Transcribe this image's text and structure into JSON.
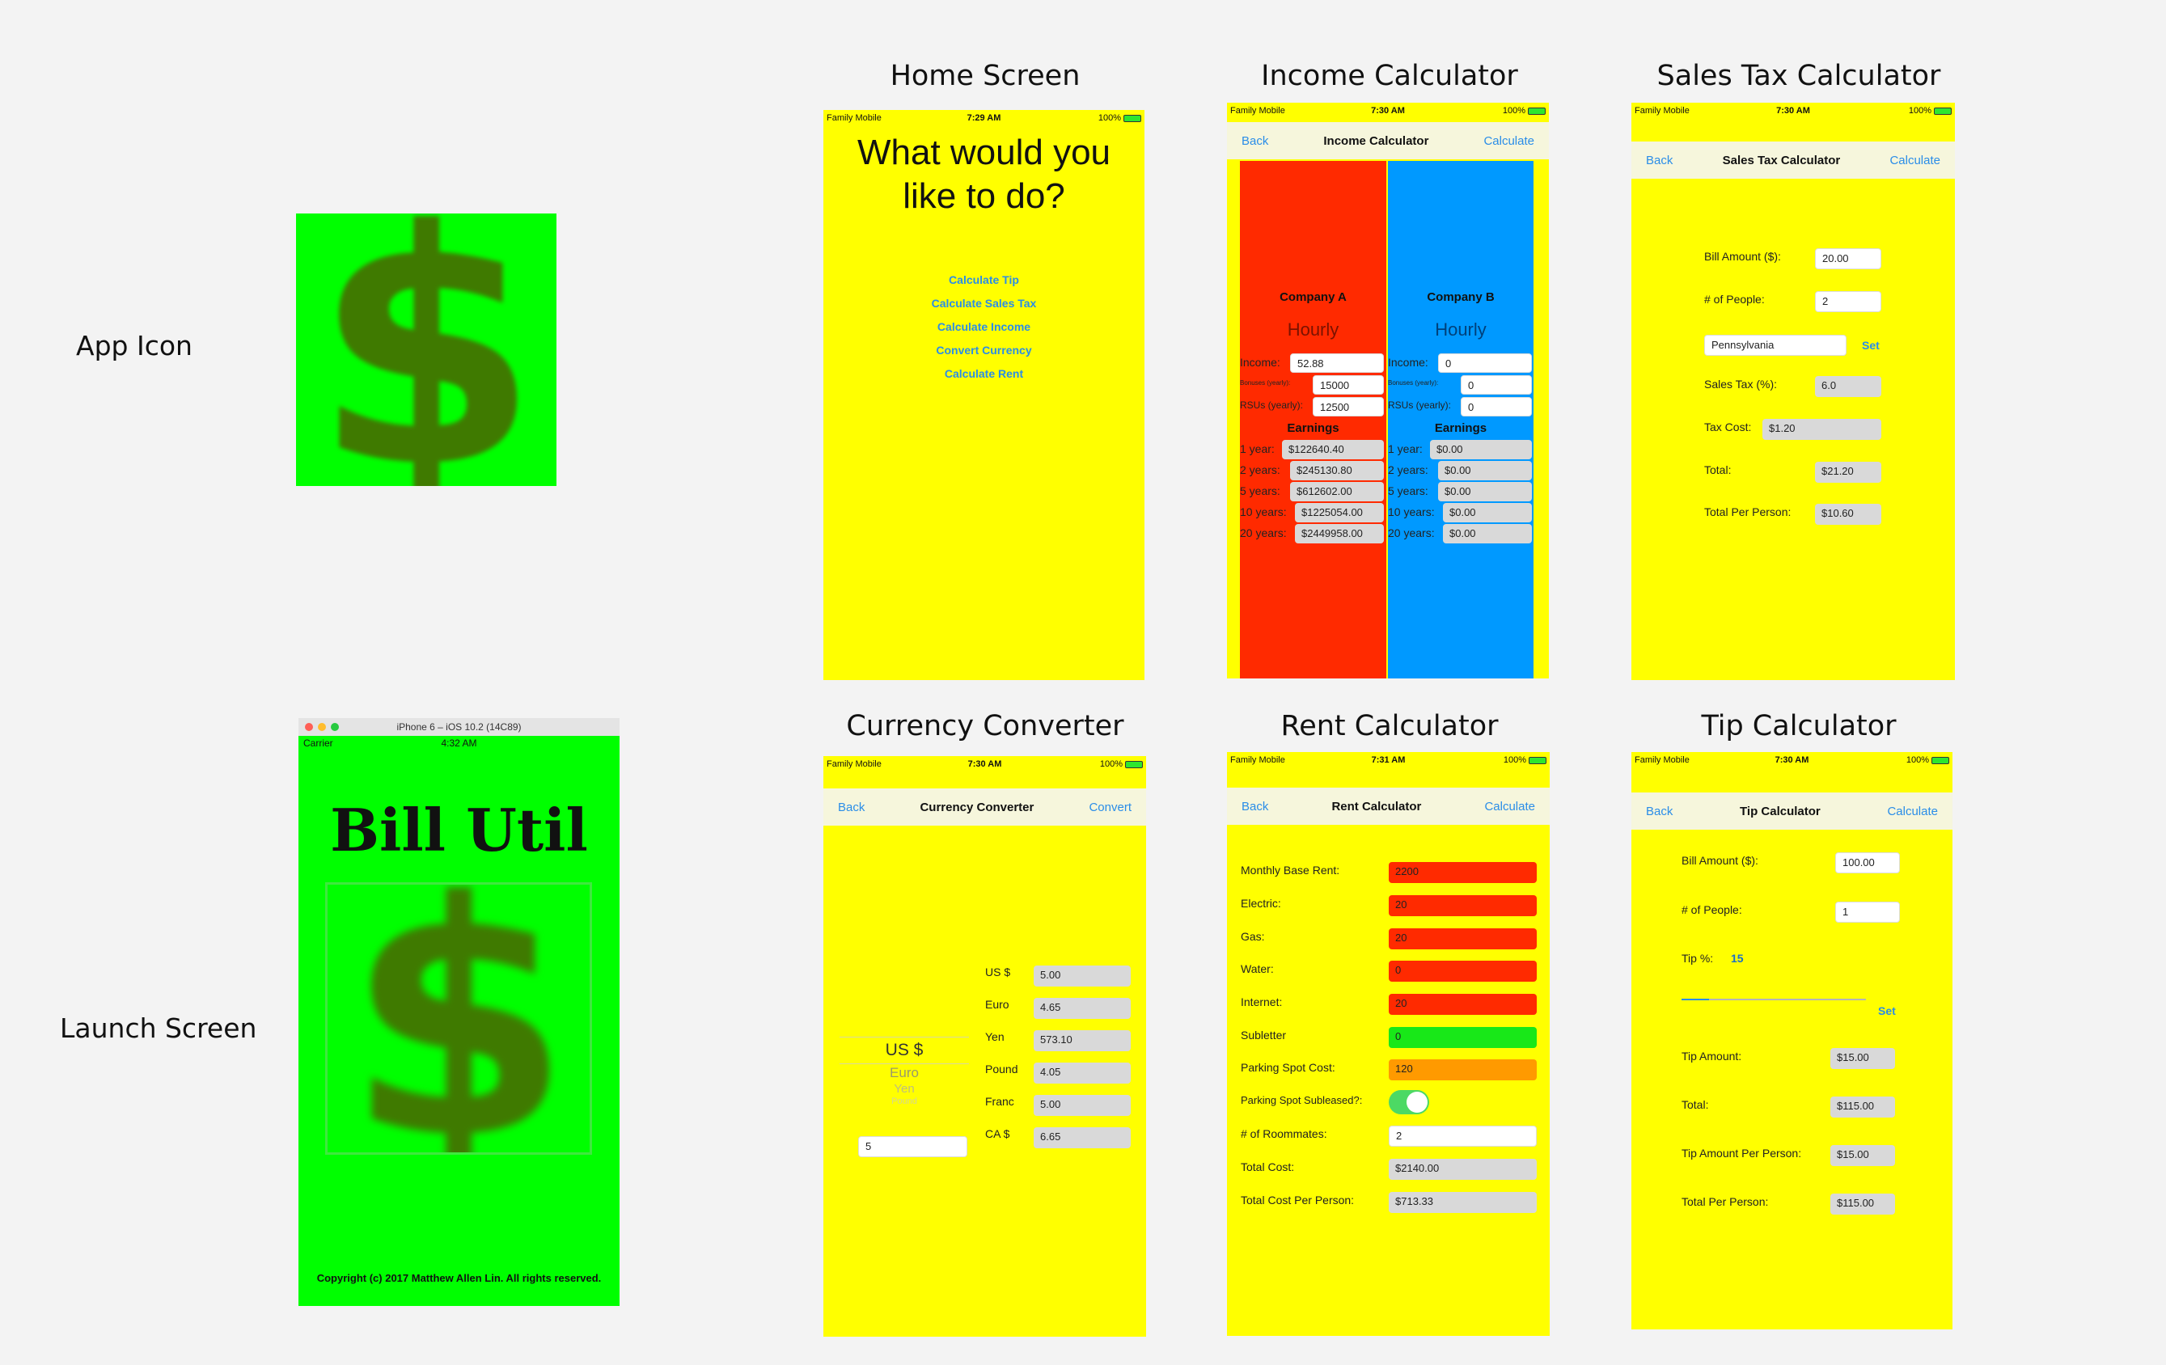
{
  "labels": {
    "app_icon": "App Icon",
    "launch_screen": "Launch Screen"
  },
  "titles": {
    "home": "Home Screen",
    "income": "Income Calculator",
    "sales": "Sales Tax Calculator",
    "currency": "Currency Converter",
    "rent": "Rent Calculator",
    "tip": "Tip Calculator"
  },
  "status": {
    "carrier": "Family Mobile",
    "battery": "100%",
    "t_home": "7:29 AM",
    "t_income": "7:30 AM",
    "t_sales": "7:30 AM",
    "t_currency": "7:30 AM",
    "t_rent": "7:31 AM",
    "t_tip": "7:30 AM"
  },
  "app_icon": {
    "glyph": "$"
  },
  "launch": {
    "window_title": "iPhone 6 – iOS 10.2 (14C89)",
    "carrier": "Carrier",
    "time": "4:32 AM",
    "app_name": "Bill Util",
    "glyph": "$",
    "copyright": "Copyright (c) 2017 Matthew Allen Lin. All rights reserved."
  },
  "home": {
    "heading": "What would you like to do?",
    "menu": [
      "Calculate Tip",
      "Calculate Sales Tax",
      "Calculate Income",
      "Convert Currency",
      "Calculate Rent"
    ]
  },
  "nav": {
    "back": "Back",
    "calculate": "Calculate",
    "convert": "Convert",
    "set": "Set"
  },
  "income": {
    "a": {
      "name": "Company A",
      "mode": "Hourly",
      "income_label": "Income:",
      "income": "52.88",
      "bonuses_label": "Bonuses (yearly):",
      "bonuses": "15000",
      "rsus_label": "RSUs (yearly):",
      "rsus": "12500",
      "earnings": "Earnings",
      "rows": [
        [
          "1 year:",
          "$122640.40"
        ],
        [
          "2 years:",
          "$245130.80"
        ],
        [
          "5 years:",
          "$612602.00"
        ],
        [
          "10 years:",
          "$1225054.00"
        ],
        [
          "20 years:",
          "$2449958.00"
        ]
      ]
    },
    "b": {
      "name": "Company B",
      "mode": "Hourly",
      "income_label": "Income:",
      "income": "0",
      "bonuses_label": "Bonuses (yearly):",
      "bonuses": "0",
      "rsus_label": "RSUs (yearly):",
      "rsus": "0",
      "earnings": "Earnings",
      "rows": [
        [
          "1 year:",
          "$0.00"
        ],
        [
          "2 years:",
          "$0.00"
        ],
        [
          "5 years:",
          "$0.00"
        ],
        [
          "10 years:",
          "$0.00"
        ],
        [
          "20 years:",
          "$0.00"
        ]
      ]
    }
  },
  "sales": {
    "bill_label": "Bill Amount ($):",
    "bill": "20.00",
    "people_label": "# of People:",
    "people": "2",
    "state": "Pennsylvania",
    "tax_label": "Sales Tax (%):",
    "tax": "6.0",
    "cost_label": "Tax Cost:",
    "cost": "$1.20",
    "total_label": "Total:",
    "total": "$21.20",
    "pp_label": "Total Per Person:",
    "pp": "$10.60"
  },
  "currency": {
    "rows": [
      [
        "US $",
        "5.00"
      ],
      [
        "Euro",
        "4.65"
      ],
      [
        "Yen",
        "573.10"
      ],
      [
        "Pound",
        "4.05"
      ],
      [
        "Franc",
        "5.00"
      ],
      [
        "CA $",
        "6.65"
      ]
    ],
    "picker": [
      "US $",
      "Euro",
      "Yen",
      "Pound"
    ],
    "input": "5"
  },
  "rent": {
    "rows": [
      [
        "Monthly Base Rent:",
        "2200",
        "#ff2a00"
      ],
      [
        "Electric:",
        "20",
        "#ff2a00"
      ],
      [
        "Gas:",
        "20",
        "#ff2a00"
      ],
      [
        "Water:",
        "0",
        "#ff2a00"
      ],
      [
        "Internet:",
        "20",
        "#ff2a00"
      ],
      [
        "Subletter",
        "0",
        "#18e818"
      ],
      [
        "Parking Spot Cost:",
        "120",
        "#ff9a00"
      ]
    ],
    "subleased_label": "Parking Spot Subleased?:",
    "roommates_label": "# of Roommates:",
    "roommates": "2",
    "total_label": "Total Cost:",
    "total": "$2140.00",
    "pp_label": "Total Cost Per Person:",
    "pp": "$713.33"
  },
  "tip": {
    "bill_label": "Bill Amount ($):",
    "bill": "100.00",
    "people_label": "# of People:",
    "people": "1",
    "tip_label": "Tip %:",
    "tip": "15",
    "slider_fraction": 0.15,
    "amount_label": "Tip Amount:",
    "amount": "$15.00",
    "total_label": "Total:",
    "total": "$115.00",
    "app_label": "Tip Amount Per Person:",
    "app": "$15.00",
    "tpp_label": "Total Per Person:",
    "tpp": "$115.00"
  },
  "colors": {
    "yellow": "#ffff00",
    "green": "#00ff00",
    "dark_green": "#3f7a00",
    "red": "#ff2a00",
    "blue": "#0099ff",
    "link": "#2a8de8"
  }
}
